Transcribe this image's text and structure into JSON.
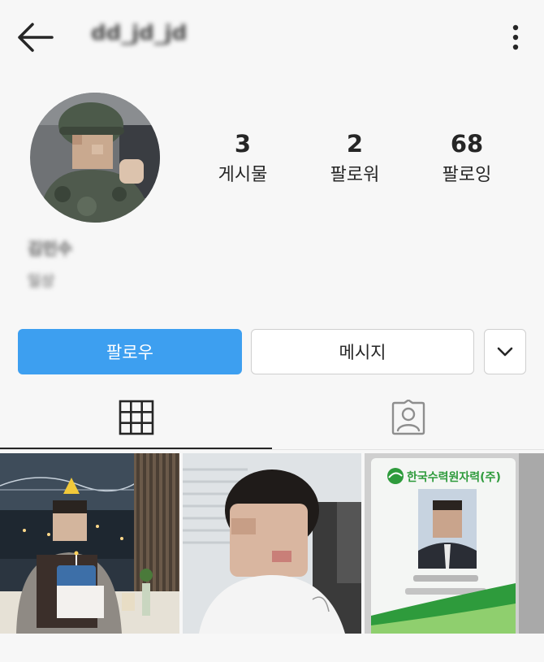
{
  "header": {
    "username": "dd_jd_jd",
    "back_icon": "arrow-left-icon",
    "more_icon": "more-vertical-icon"
  },
  "profile": {
    "stats": [
      {
        "count": "3",
        "label": "게시물"
      },
      {
        "count": "2",
        "label": "팔로워"
      },
      {
        "count": "68",
        "label": "팔로잉"
      }
    ],
    "name": "김민수",
    "bio": "일상"
  },
  "actions": {
    "follow_label": "팔로우",
    "message_label": "메시지",
    "dropdown_icon": "chevron-down-icon"
  },
  "tabs": [
    {
      "name": "grid",
      "icon": "grid-icon",
      "active": true
    },
    {
      "name": "tagged",
      "icon": "tagged-person-icon",
      "active": false
    }
  ],
  "posts": [
    {
      "description": "birthday-cake-night"
    },
    {
      "description": "selfie"
    },
    {
      "description": "id-card",
      "card_text": "한국수력원자력(주)"
    }
  ],
  "colors": {
    "accent": "#3d9ff0",
    "background": "#f7f7f7",
    "text": "#262626",
    "id_card_green": "#2e9b3c"
  }
}
